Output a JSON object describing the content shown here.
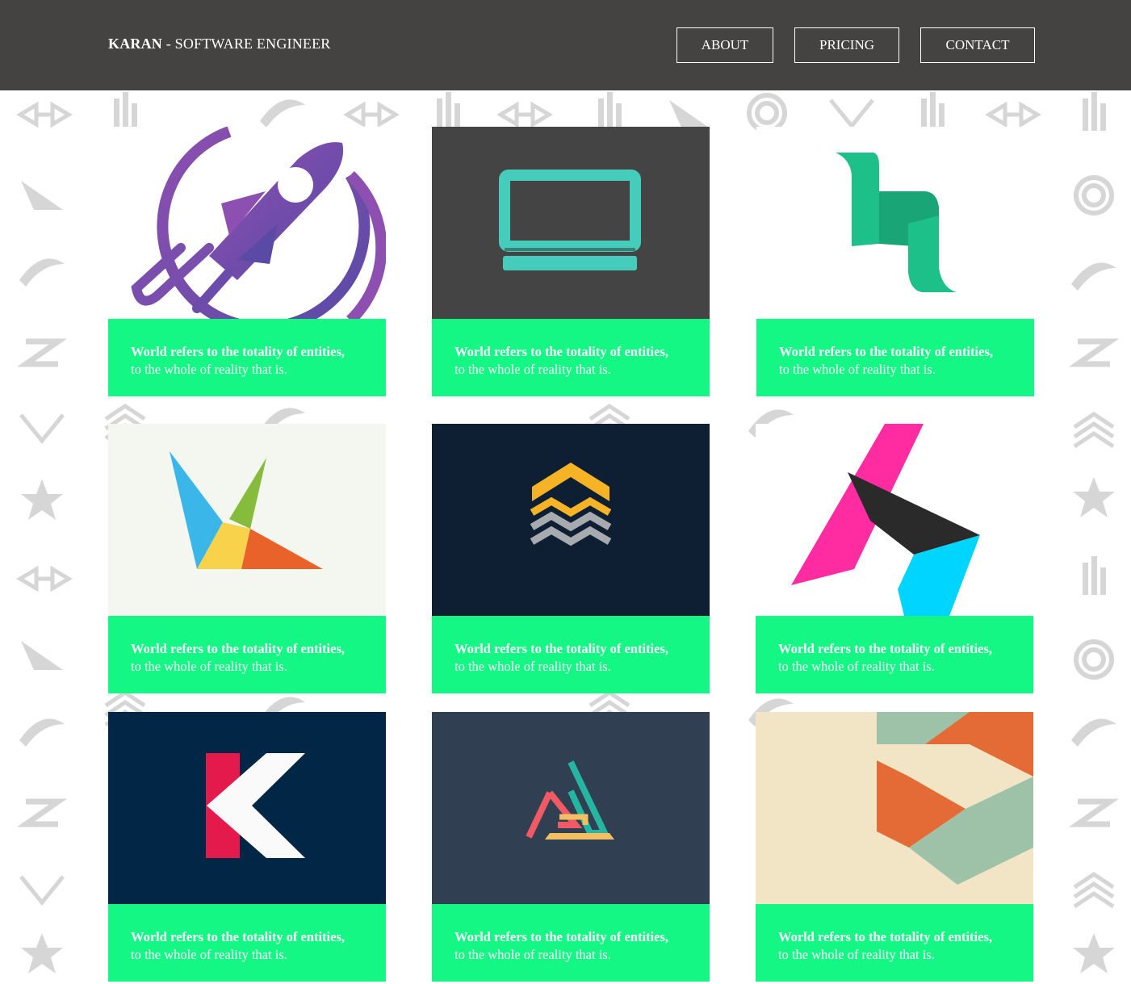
{
  "header": {
    "brand_name": "KARAN",
    "brand_sep": " - ",
    "brand_role": "SOFTWARE ENGINEER",
    "nav": {
      "about": "ABOUT",
      "pricing": "PRICING",
      "contact": "CONTACT"
    },
    "background_color": "#444341"
  },
  "colors": {
    "caption_bg": "#14f785",
    "caption_text": "#ffffff"
  },
  "cards": [
    {
      "icon": "rocket-logo-icon",
      "bg": "#ffffff",
      "caption_bold": "World refers to the totality of entities,",
      "caption_rest": "to the whole of reality that is."
    },
    {
      "icon": "laptop-logo-icon",
      "bg": "#444444",
      "caption_bold": "World refers to the totality of entities,",
      "caption_rest": "to the whole of reality that is."
    },
    {
      "icon": "h-ribbon-logo-icon",
      "bg": "#ffffff",
      "caption_bold": "World refers to the totality of entities,",
      "caption_rest": "to the whole of reality that is."
    },
    {
      "icon": "k-triangles-logo-icon",
      "bg": "#f4f7ef",
      "caption_bold": "World refers to the totality of entities,",
      "caption_rest": "to the whole of reality that is."
    },
    {
      "icon": "layers-logo-icon",
      "bg": "#0e1f33",
      "caption_bold": "World refers to the totality of entities,",
      "caption_rest": "to the whole of reality that is."
    },
    {
      "icon": "geometric-h-logo-icon",
      "bg": "#ffffff",
      "caption_bold": "World refers to the totality of entities,",
      "caption_rest": "to the whole of reality that is."
    },
    {
      "icon": "k-letter-logo-icon",
      "bg": "#022645",
      "caption_bold": "World refers to the totality of entities,",
      "caption_rest": "to the whole of reality that is."
    },
    {
      "icon": "triangle-knot-logo-icon",
      "bg": "#303f51",
      "caption_bold": "World refers to the totality of entities,",
      "caption_rest": "to the whole of reality that is."
    },
    {
      "icon": "hexagon-pattern-logo-icon",
      "bg": "#f2e5c6",
      "caption_bold": "World refers to the totality of entities,",
      "caption_rest": "to the whole of reality that is."
    }
  ]
}
